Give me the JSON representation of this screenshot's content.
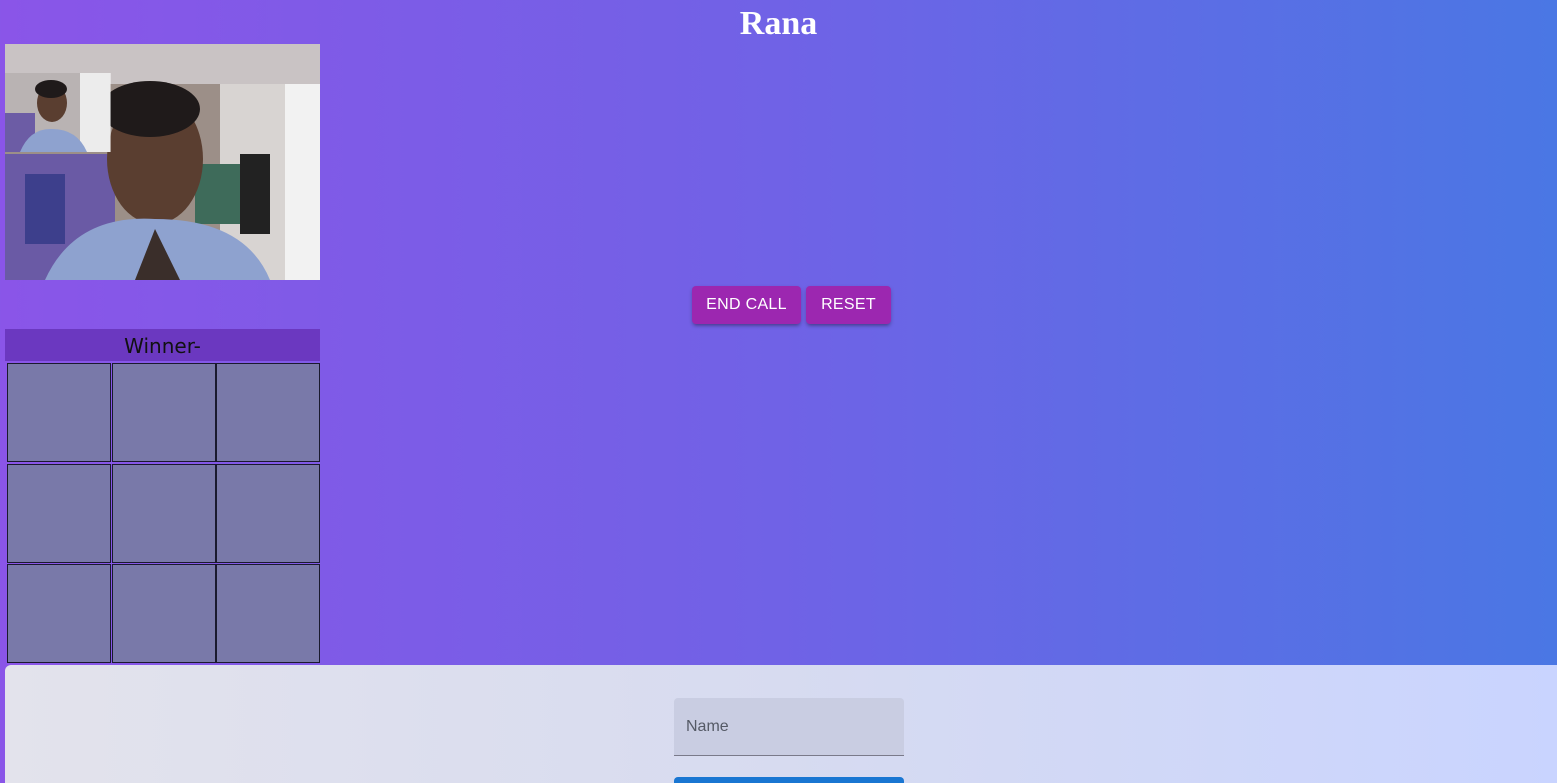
{
  "header": {
    "title": "Rana"
  },
  "video": {
    "main_label": "remote-video",
    "pip_label": "local-video"
  },
  "controls": {
    "end_call_label": "END CALL",
    "reset_label": "RESET"
  },
  "game": {
    "winner_label": "Winner-",
    "cells": [
      "",
      "",
      "",
      "",
      "",
      "",
      "",
      "",
      ""
    ]
  },
  "form": {
    "name_placeholder": "Name",
    "name_value": ""
  },
  "colors": {
    "accent": "#9c27b0",
    "primary": "#1976d2",
    "cell": "#7979a9",
    "winner_bar": "#6b38c0"
  }
}
